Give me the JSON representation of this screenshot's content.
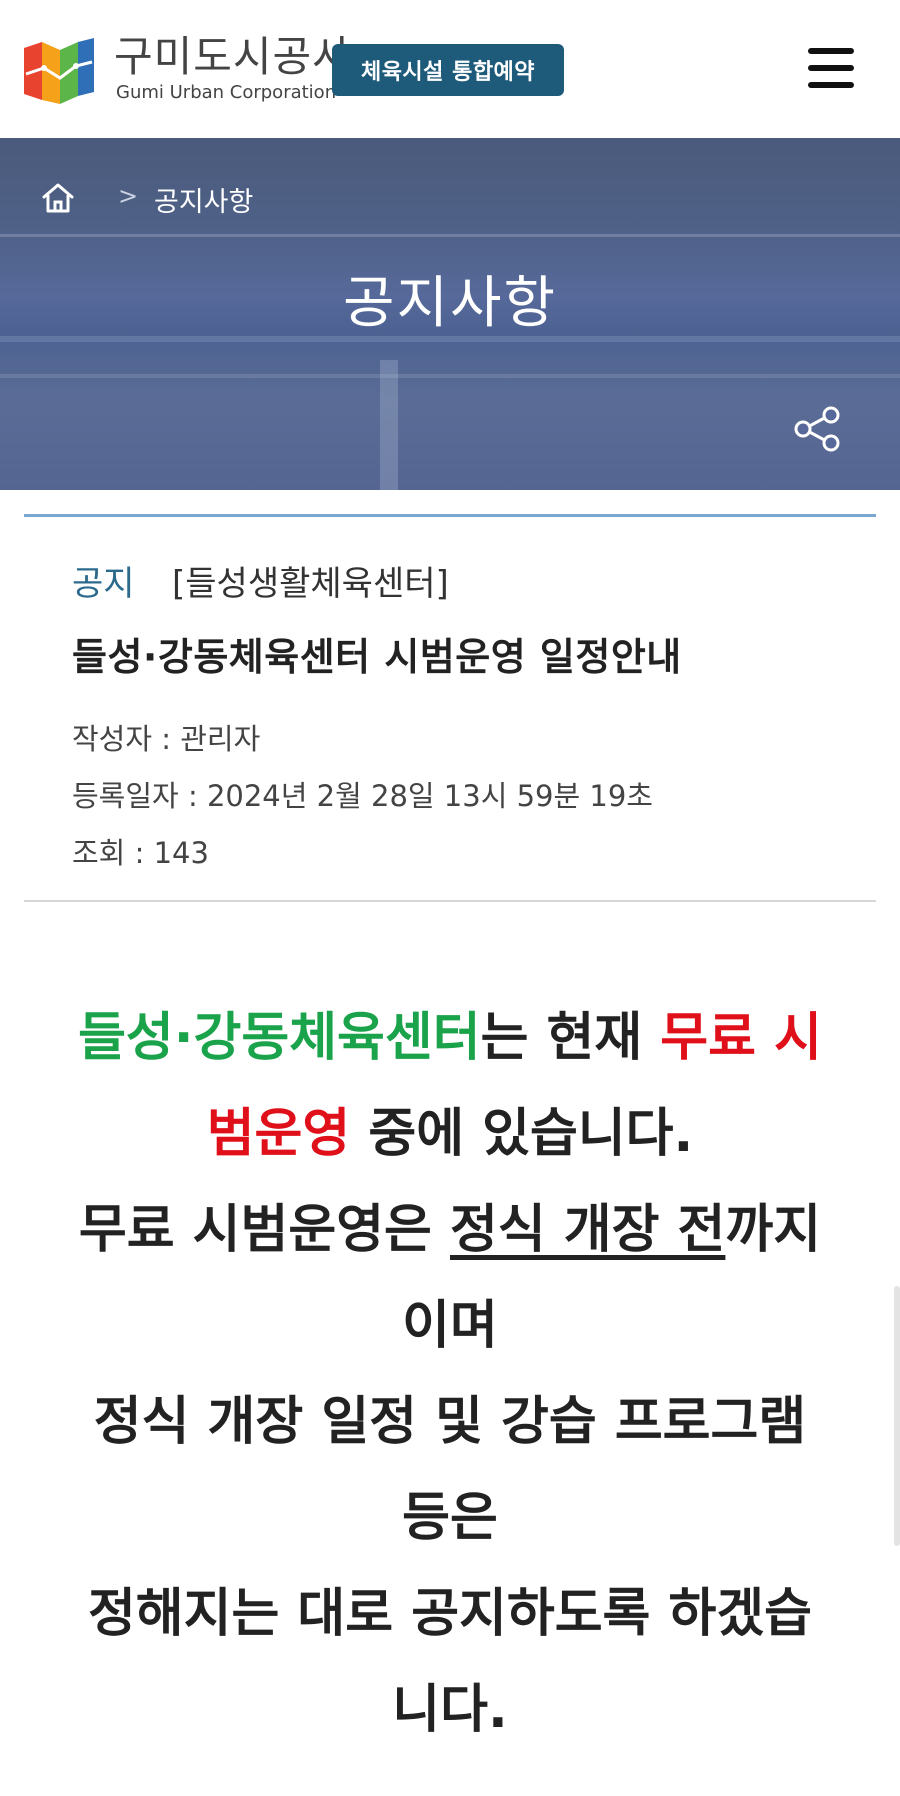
{
  "header": {
    "logo_kor": "구미도시공사",
    "logo_eng": "Gumi Urban Corporation",
    "badge": "체육시설 통합예약",
    "menu_icon": "hamburger-menu-icon"
  },
  "banner": {
    "breadcrumb_sep": ">",
    "breadcrumb_current": "공지사항",
    "title": "공지사항",
    "home_icon": "home-icon",
    "share_icon": "share-icon"
  },
  "post": {
    "category": "공지",
    "subcategory": "[들성생활체육센터]",
    "title": "들성·강동체육센터 시범운영 일정안내",
    "author_label": "작성자 : ",
    "author": "관리자",
    "date_label": "등록일자 : ",
    "date": "2024년 2월 28일 13시 59분 19초",
    "views_label": "조회 : ",
    "views": "143"
  },
  "content": {
    "l1_green": "들성·강동체육센터",
    "l1_mid": "는 현재 ",
    "l1_red": "무료 시",
    "l2_red": "범운영",
    "l2_rest": " 중에 있습니다.",
    "l3_start": "무료 시범운영은 ",
    "l3_under": "정식 개장 전",
    "l3_end": "까지",
    "l4": "이며",
    "l5": "정식 개장 일정 및 강습 프로그램",
    "l6": "등은",
    "l7": "정해지는 대로 공지하도록 하겠습",
    "l8": "니다."
  },
  "colors": {
    "accent_green": "#1aa34a",
    "accent_red": "#e0101a",
    "badge_bg": "#1e5a7a"
  }
}
